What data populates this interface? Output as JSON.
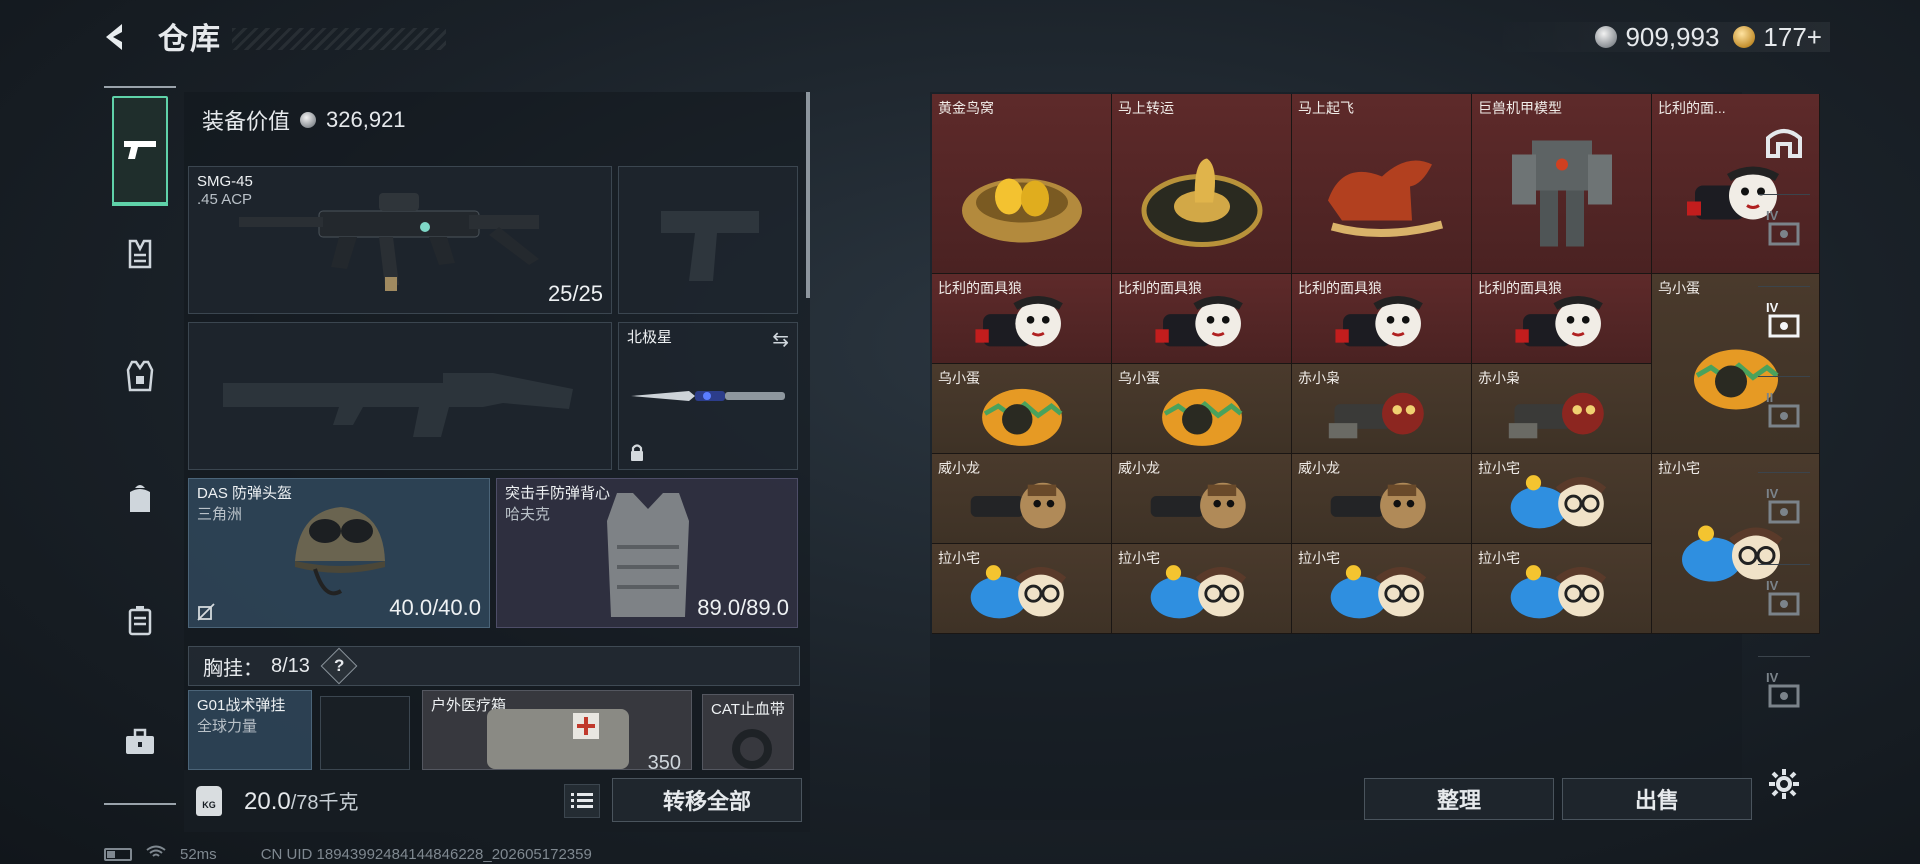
{
  "header": {
    "title": "仓库",
    "currency_silver": "909,993",
    "currency_gold": "177+"
  },
  "loadout": {
    "equip_value_label": "装备价值",
    "equip_value": "326,921",
    "primary": {
      "name": "SMG-45",
      "ammo": ".45 ACP",
      "count": "25/25"
    },
    "melee": {
      "name": "北极星"
    },
    "helmet": {
      "name": "DAS 防弹头盔",
      "sub": "三角洲",
      "durability": "40.0/40.0"
    },
    "armor": {
      "name": "突击手防弹背心",
      "sub": "哈夫克",
      "durability": "89.0/89.0"
    },
    "chest_rig": {
      "label": "胸挂：",
      "value": "8/13",
      "help": "?"
    },
    "items": [
      {
        "name": "G01战术弹挂",
        "sub": "全球力量"
      },
      {
        "name": "户外医疗箱",
        "count": "350"
      },
      {
        "name": "CAT止血带"
      }
    ],
    "weight": {
      "current": "20.0",
      "max": "/78千克",
      "icon": "KG"
    },
    "transfer_all": "转移全部"
  },
  "status": {
    "ping": "52ms",
    "uid": "CN UID 18943992484144846228_202605172359"
  },
  "storage": {
    "cells": [
      {
        "label": "黄金鸟窝",
        "icon": "golden-nest-icon"
      },
      {
        "label": "马上转运",
        "icon": "fortune-wheel-icon"
      },
      {
        "label": "马上起飞",
        "icon": "red-horse-icon"
      },
      {
        "label": "巨兽机甲模型",
        "icon": "mech-model-icon"
      },
      {
        "label": "比利的面...",
        "icon": "billy-doll-icon"
      },
      {
        "label": "比利的面具狼",
        "icon": "billy-doll-icon"
      },
      {
        "label": "比利的面具狼",
        "icon": "billy-doll-icon"
      },
      {
        "label": "比利的面具狼",
        "icon": "billy-doll-icon"
      },
      {
        "label": "比利的面具狼",
        "icon": "billy-doll-icon"
      },
      {
        "label": "乌小蛋",
        "icon": "egg-doll-icon"
      },
      {
        "label": "乌小蛋",
        "icon": "egg-doll-icon"
      },
      {
        "label": "乌小蛋",
        "icon": "egg-doll-icon"
      },
      {
        "label": "赤小枭",
        "icon": "red-owl-doll-icon"
      },
      {
        "label": "赤小枭",
        "icon": "red-owl-doll-icon"
      },
      {
        "label": "威小龙",
        "icon": "dragon-doll-icon"
      },
      {
        "label": "威小龙",
        "icon": "dragon-doll-icon"
      },
      {
        "label": "威小龙",
        "icon": "dragon-doll-icon"
      },
      {
        "label": "拉小宅",
        "icon": "otaku-doll-icon"
      },
      {
        "label": "拉小宅",
        "icon": "otaku-doll-icon"
      },
      {
        "label": "拉小宅",
        "icon": "otaku-doll-icon"
      },
      {
        "label": "拉小宅",
        "icon": "otaku-doll-icon"
      },
      {
        "label": "拉小宅",
        "icon": "otaku-doll-icon"
      },
      {
        "label": "拉小宅",
        "icon": "otaku-doll-icon"
      }
    ],
    "sidebar_labels": [
      "IV",
      "IV",
      "II",
      "IV",
      "IV",
      "IV"
    ],
    "sort_button": "整理",
    "sell_button": "出售"
  },
  "colors": {
    "accent": "#5fd2a9",
    "rare_red": "#5e2a2a",
    "common_brown": "#4a3a2c"
  }
}
